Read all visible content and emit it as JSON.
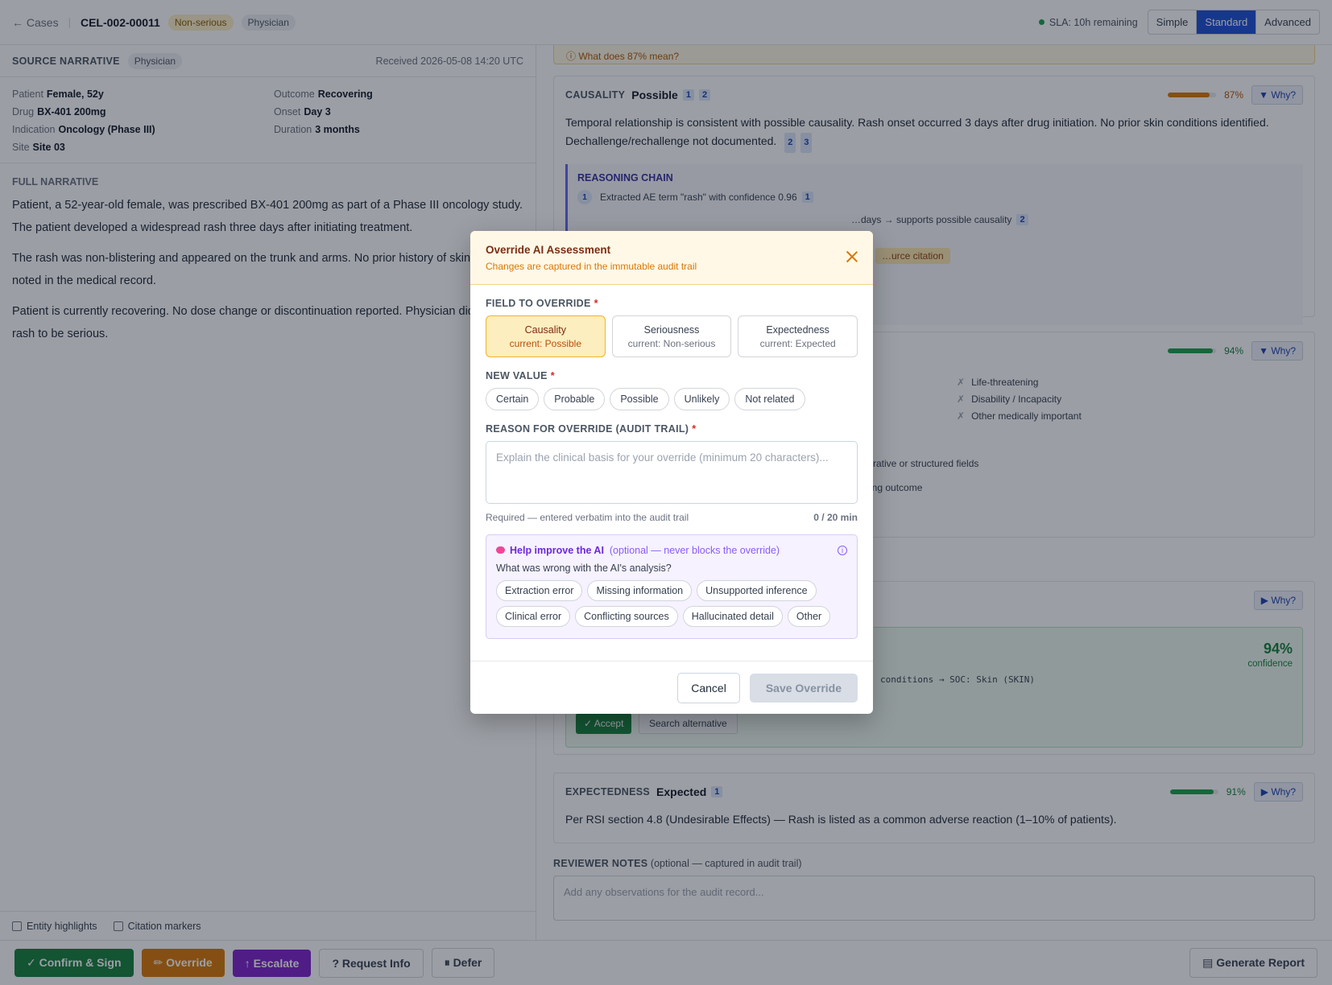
{
  "topbar": {
    "back_label": "← Cases",
    "case_id": "CEL-002-00011",
    "seriousness_badge": "Non-serious",
    "reporter_badge": "Physician",
    "sla": "SLA: 10h remaining",
    "modes": [
      "Simple",
      "Standard",
      "Advanced"
    ],
    "active_mode": "Standard"
  },
  "source": {
    "title": "SOURCE NARRATIVE",
    "reporter": "Physician",
    "received": "Received 2026-05-08 14:20 UTC",
    "meta": {
      "patient_k": "Patient",
      "patient_v": "Female, 52y",
      "outcome_k": "Outcome",
      "outcome_v": "Recovering",
      "drug_k": "Drug",
      "drug_v": "BX-401 200mg",
      "onset_k": "Onset",
      "onset_v": "Day 3",
      "indication_k": "Indication",
      "indication_v": "Oncology (Phase III)",
      "duration_k": "Duration",
      "duration_v": "3 months",
      "site_k": "Site",
      "site_v": "Site 03"
    },
    "full_title": "FULL NARRATIVE",
    "para1": "Patient, a 52-year-old female, was prescribed BX-401 200mg as part of a Phase III oncology study. The patient developed a widespread rash three days after initiating treatment.",
    "para2": "The rash was non-blistering and appeared on the trunk and arms. No prior history of skin co… was noted in the medical record.",
    "para3": "Patient is currently recovering. No dose change or discontinuation reported. Physician did no… the rash to be serious.",
    "entity_highlights": "Entity highlights",
    "citation_markers": "Citation markers"
  },
  "assessment": {
    "info_link": "ⓘ What does 87% mean?",
    "causality": {
      "label": "CAUSALITY",
      "value": "Possible",
      "cites": [
        "1",
        "2"
      ],
      "confidence": 87,
      "pct": "87%",
      "why": "▼ Why?",
      "text": "Temporal relationship is consistent with possible causality. Rash onset occurred 3 days after drug initiation. No prior skin conditions identified. Dechallenge/rechallenge not documented.",
      "text_cites": [
        "2",
        "3"
      ],
      "reasoning_title": "REASONING CHAIN",
      "step1": "Extracted AE term \"rash\" with confidence 0.96",
      "step1_cite": "1",
      "step2": "…days → supports possible causality",
      "step2_cite": "2",
      "warn": "…urce citation"
    },
    "seriousness": {
      "pct": "94%",
      "confidence": 94,
      "why": "▼ Why?",
      "criteria": [
        "Life-threatening",
        "Disability / Incapacity",
        "Other medically important"
      ],
      "note1": "…rrative or structured fields",
      "note2": "…ing outcome"
    },
    "meddra": {
      "why": "▶ Why?",
      "pct": "94%",
      "conf_label": "confidence",
      "mapping": "conditions → SOC: Skin (SKIN)",
      "accept": "✓ Accept",
      "search": "Search alternative"
    },
    "expectedness": {
      "label": "EXPECTEDNESS",
      "value": "Expected",
      "cite": "1",
      "confidence": 91,
      "pct": "91%",
      "why": "▶ Why?",
      "text": "Per RSI section 4.8 (Undesirable Effects) — Rash is listed as a common adverse reaction (1–10% of patients)."
    },
    "notes_label": "REVIEWER NOTES",
    "notes_hint": "(optional — captured in audit trail)",
    "notes_placeholder": "Add any observations for the audit record..."
  },
  "footer": {
    "confirm": "✓ Confirm & Sign",
    "override": "✏ Override",
    "escalate": "↑ Escalate",
    "request": "? Request Info",
    "defer": "⏸ Defer",
    "report": "▤ Generate Report"
  },
  "modal": {
    "title": "Override AI Assessment",
    "subtitle": "Changes are captured in the immutable audit trail",
    "field_label": "FIELD TO OVERRIDE",
    "fields": [
      {
        "name": "Causality",
        "current": "current: Possible"
      },
      {
        "name": "Seriousness",
        "current": "current: Non-serious"
      },
      {
        "name": "Expectedness",
        "current": "current: Expected"
      }
    ],
    "selected_field": "Causality",
    "new_value_label": "NEW VALUE",
    "values": [
      "Certain",
      "Probable",
      "Possible",
      "Unlikely",
      "Not related"
    ],
    "reason_label": "REASON FOR OVERRIDE (AUDIT TRAIL)",
    "reason_placeholder": "Explain the clinical basis for your override (minimum 20 characters)...",
    "reason_hint": "Required — entered verbatim into the audit trail",
    "char_count": "0 / 20 min",
    "help_title": "Help improve the AI",
    "help_optional": "(optional — never blocks the override)",
    "help_question": "What was wrong with the AI's analysis?",
    "tags": [
      "Extraction error",
      "Missing information",
      "Unsupported inference",
      "Clinical error",
      "Conflicting sources",
      "Hallucinated detail",
      "Other"
    ],
    "cancel": "Cancel",
    "save": "Save Override"
  },
  "colors": {
    "accent": "#1d4ed8",
    "amber": "#d97706",
    "green": "#15803d",
    "purple": "#7e22ce"
  }
}
